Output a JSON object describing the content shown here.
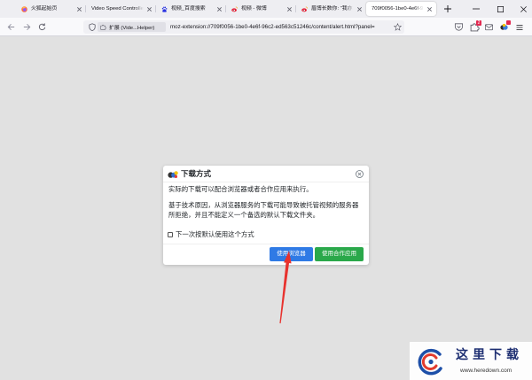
{
  "browser": {
    "tabs": [
      {
        "label": "火狐起始页",
        "icon": "firefox-icon",
        "active": false
      },
      {
        "label": "Video Speed Controlle",
        "active": false
      },
      {
        "label": "视频_百度搜索",
        "icon": "baidu-icon",
        "active": false
      },
      {
        "label": "视频 - 微博",
        "icon": "weibo-icon",
        "active": false
      },
      {
        "label": "眉博长数你: “我亦",
        "icon": "weibo-icon",
        "active": false
      },
      {
        "label": "709f0056-1be0-4e6f-9",
        "active": true
      }
    ],
    "window_controls": [
      "minimize-icon",
      "maximize-icon",
      "close-icon"
    ],
    "address_bar": {
      "identity_label": "扩展 (Vide...Helper)",
      "url": "moz-extension://709f0056-1be0-4e6f-96c2-ed563c51246c/content/alert.html?panel="
    },
    "toolbar": {
      "icons": [
        "pocket-icon",
        "extensions-icon",
        "mail-icon",
        "downloadhelper-icon",
        "menu-icon"
      ],
      "extensions_badge": "2"
    }
  },
  "dialog": {
    "title": "下载方式",
    "message": "实际的下载可以配合浏览器或者合作应用来执行。",
    "note": "基于技术原因，从浏览器服务的下载可能导致被托管视频的服务器所拒绝，并且不能定义一个备选的默认下载文件夹。",
    "remember_label": "下一次按默认使用这个方式",
    "remember_checked": false,
    "buttons": {
      "browser": "使用浏览器",
      "companion": "使用合作应用"
    }
  },
  "watermark": {
    "brand": "这里下载",
    "url": "www.heredown.com"
  },
  "colors": {
    "primary": "#2f7ae5",
    "success": "#2aa84a",
    "annotation": "#e8322e",
    "watermark_text": "#1e2f72"
  }
}
